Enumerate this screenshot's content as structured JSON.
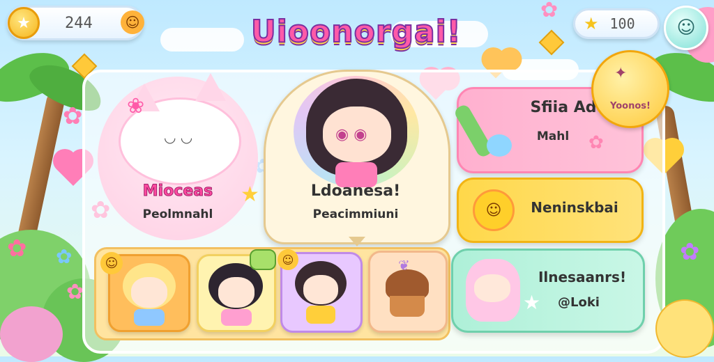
{
  "hud": {
    "coins": "244",
    "stars": "100"
  },
  "title": "Uioonorgai!",
  "featured": [
    {
      "name": "Mioceas",
      "subtitle": "Peolmnahl"
    },
    {
      "name": "Ldoanesa!",
      "subtitle": "Peacimmiuni"
    }
  ],
  "menu": [
    {
      "title": "Sfiia Ad",
      "subtitle": "Mahl"
    },
    {
      "title": "Neninskbai"
    },
    {
      "title": "Ilnesaanrs!",
      "subtitle": "@Loki"
    }
  ],
  "badge": "Yoonos!",
  "colors": {
    "pink": "#ff5aa8",
    "yellow": "#ffd84a",
    "mint": "#9be8c8",
    "purple": "#7a2fa0"
  }
}
